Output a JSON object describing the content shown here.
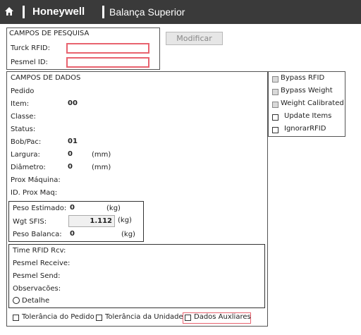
{
  "header": {
    "brand": "Honeywell",
    "title": "Balança Superior"
  },
  "search": {
    "title": "CAMPOS DE PESQUISA",
    "turck_label": "Turck RFID:",
    "turck_value": "",
    "pesmel_label": "Pesmel ID:",
    "pesmel_value": ""
  },
  "modify_button": "Modificar",
  "data_fields": {
    "title": "CAMPOS DE DADOS",
    "pedido_label": "Pedido",
    "item_label": "Item:",
    "item_value": "00",
    "classe_label": "Classe:",
    "status_label": "Status:",
    "bobpac_label": "Bob/Pac:",
    "bobpac_value": "01",
    "largura_label": "Largura:",
    "largura_value": "0",
    "largura_unit": "(mm)",
    "diametro_label": "Diâmetro:",
    "diametro_value": "0",
    "diametro_unit": "(mm)",
    "prox_maquina_label": "Prox Máquina:",
    "id_prox_maq_label": "ID. Prox Maq:"
  },
  "weights": {
    "peso_estimado_label": "Peso Estimado:",
    "peso_estimado_value": "0",
    "peso_estimado_unit": "(kg)",
    "wgt_sfis_label": "Wgt SFIS:",
    "wgt_sfis_value": "1.112",
    "wgt_sfis_unit": "(kg)",
    "peso_balanca_label": "Peso Balanca:",
    "peso_balanca_value": "0",
    "peso_balanca_unit": "(kg)"
  },
  "rfid_info": {
    "time_rfid_rcv": "Time RFID Rcv:",
    "pesmel_receive": "Pesmel Receive:",
    "pesmel_send": "Pesmel Send:",
    "observacoes": "Observacões:",
    "detalhe": "Detalhe"
  },
  "options": {
    "bypass_rfid": "Bypass RFID",
    "bypass_weight": "Bypass Weight",
    "weight_calibrated": "Weight Calibrated",
    "update_items": "Update Items",
    "ignorar_rfid": "IgnorarRFID"
  },
  "bottom": {
    "tolerancia_pedido": "Tolerância do Pedido",
    "tolerancia_unidade": "Tolerância da Unidade",
    "dados_auxiliares": "Dados Auxliares"
  },
  "colors": {
    "topbar": "#3a3a3a",
    "highlight_red": "#e8636f"
  }
}
